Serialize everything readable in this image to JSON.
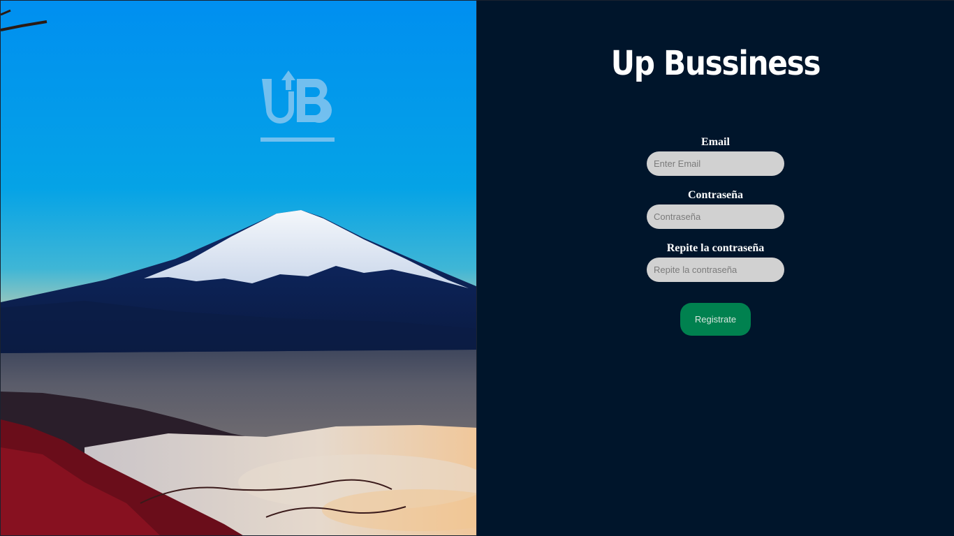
{
  "hero": {
    "logo_text": "UB"
  },
  "brand": {
    "title": "Up Bussiness"
  },
  "form": {
    "email": {
      "label": "Email",
      "placeholder": "Enter Email"
    },
    "password": {
      "label": "Contraseña",
      "placeholder": "Contraseña"
    },
    "confirm_password": {
      "label": "Repite la contraseña",
      "placeholder": "Repite la contraseña"
    },
    "submit_label": "Registrate"
  },
  "colors": {
    "panel_bg": "#00152b",
    "input_bg": "#d1d1d1",
    "button_bg": "#00814f",
    "logo": "#7fc4f0"
  }
}
